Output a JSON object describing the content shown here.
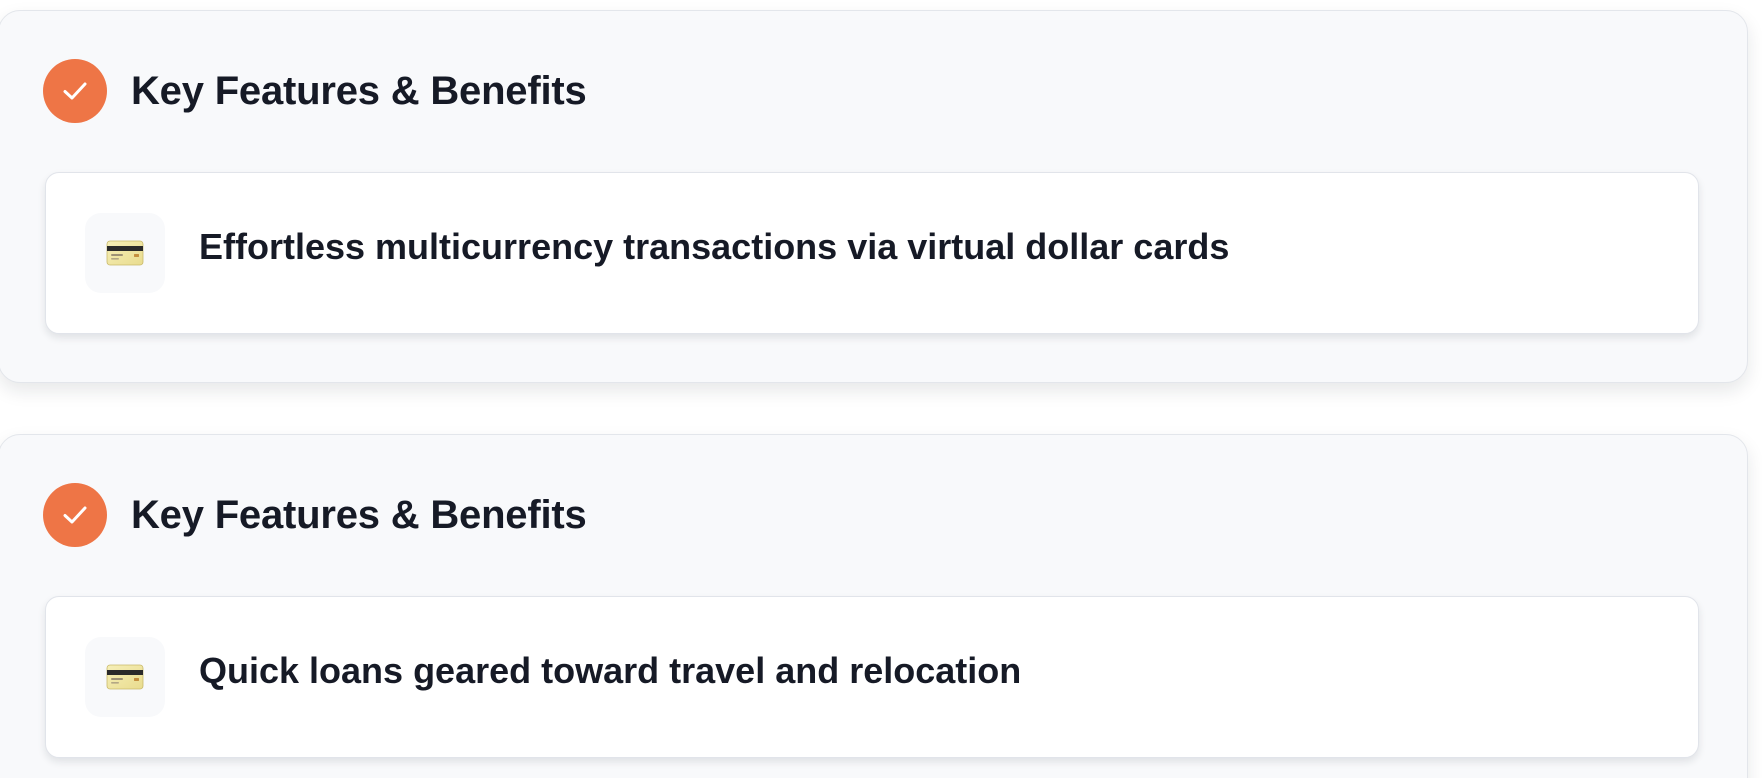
{
  "colors": {
    "accent": "#ee7546",
    "text": "#161a26",
    "section_bg": "#f8f9fb",
    "card_bg": "#ffffff",
    "border": "#e1e4ea"
  },
  "sections": [
    {
      "header_icon": "check-icon",
      "title": "Key Features & Benefits",
      "feature": {
        "icon": "credit-card-icon",
        "text": "Effortless multicurrency transactions via virtual dollar cards"
      }
    },
    {
      "header_icon": "check-icon",
      "title": "Key Features & Benefits",
      "feature": {
        "icon": "credit-card-icon",
        "text": "Quick loans geared toward travel and relocation"
      }
    }
  ]
}
